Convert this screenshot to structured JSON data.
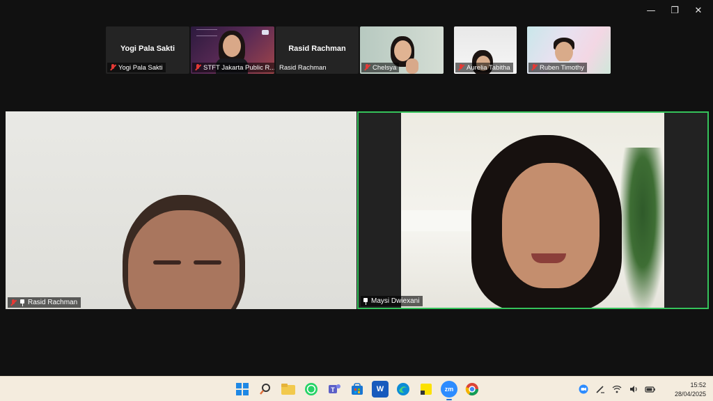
{
  "window": {
    "controls": {
      "minimize": "—",
      "restore": "❐",
      "close": "✕"
    }
  },
  "strip": {
    "tiles": [
      {
        "name": "Yogi Pala Sakti",
        "display_name": "Yogi Pala Sakti",
        "video": false
      },
      {
        "name": "STFT Jakarta Public R...",
        "video": true
      },
      {
        "name": "Rasid Rachman",
        "display_name": "Rasid Rachman",
        "video": false
      },
      {
        "name": "Chelsya",
        "video": true
      },
      {
        "name": "Aurelia Tabitha",
        "video": true
      },
      {
        "name": "Ruben Timothy",
        "video": true
      }
    ]
  },
  "main": {
    "left": {
      "name": "Rasid Rachman",
      "muted": true,
      "pinned": true
    },
    "right": {
      "name": "Maysi Dwiexani",
      "muted": false,
      "pinned": true,
      "active_speaker": true
    }
  },
  "taskbar": {
    "apps": [
      {
        "icon": "windows-start-icon"
      },
      {
        "icon": "search-icon"
      },
      {
        "icon": "file-explorer-icon"
      },
      {
        "icon": "whatsapp-icon"
      },
      {
        "icon": "teams-icon"
      },
      {
        "icon": "store-icon"
      },
      {
        "icon": "word-icon",
        "text": "W"
      },
      {
        "icon": "edge-icon"
      },
      {
        "icon": "sticky-notes-icon"
      },
      {
        "icon": "zoom-icon",
        "text": "zm"
      },
      {
        "icon": "chrome-icon"
      }
    ],
    "clock": {
      "time": "15:52",
      "date": "28/04/2025"
    }
  },
  "colors": {
    "active_speaker_border": "#35c35b",
    "mic_muted": "#e53935",
    "taskbar": "#f4ecde"
  }
}
